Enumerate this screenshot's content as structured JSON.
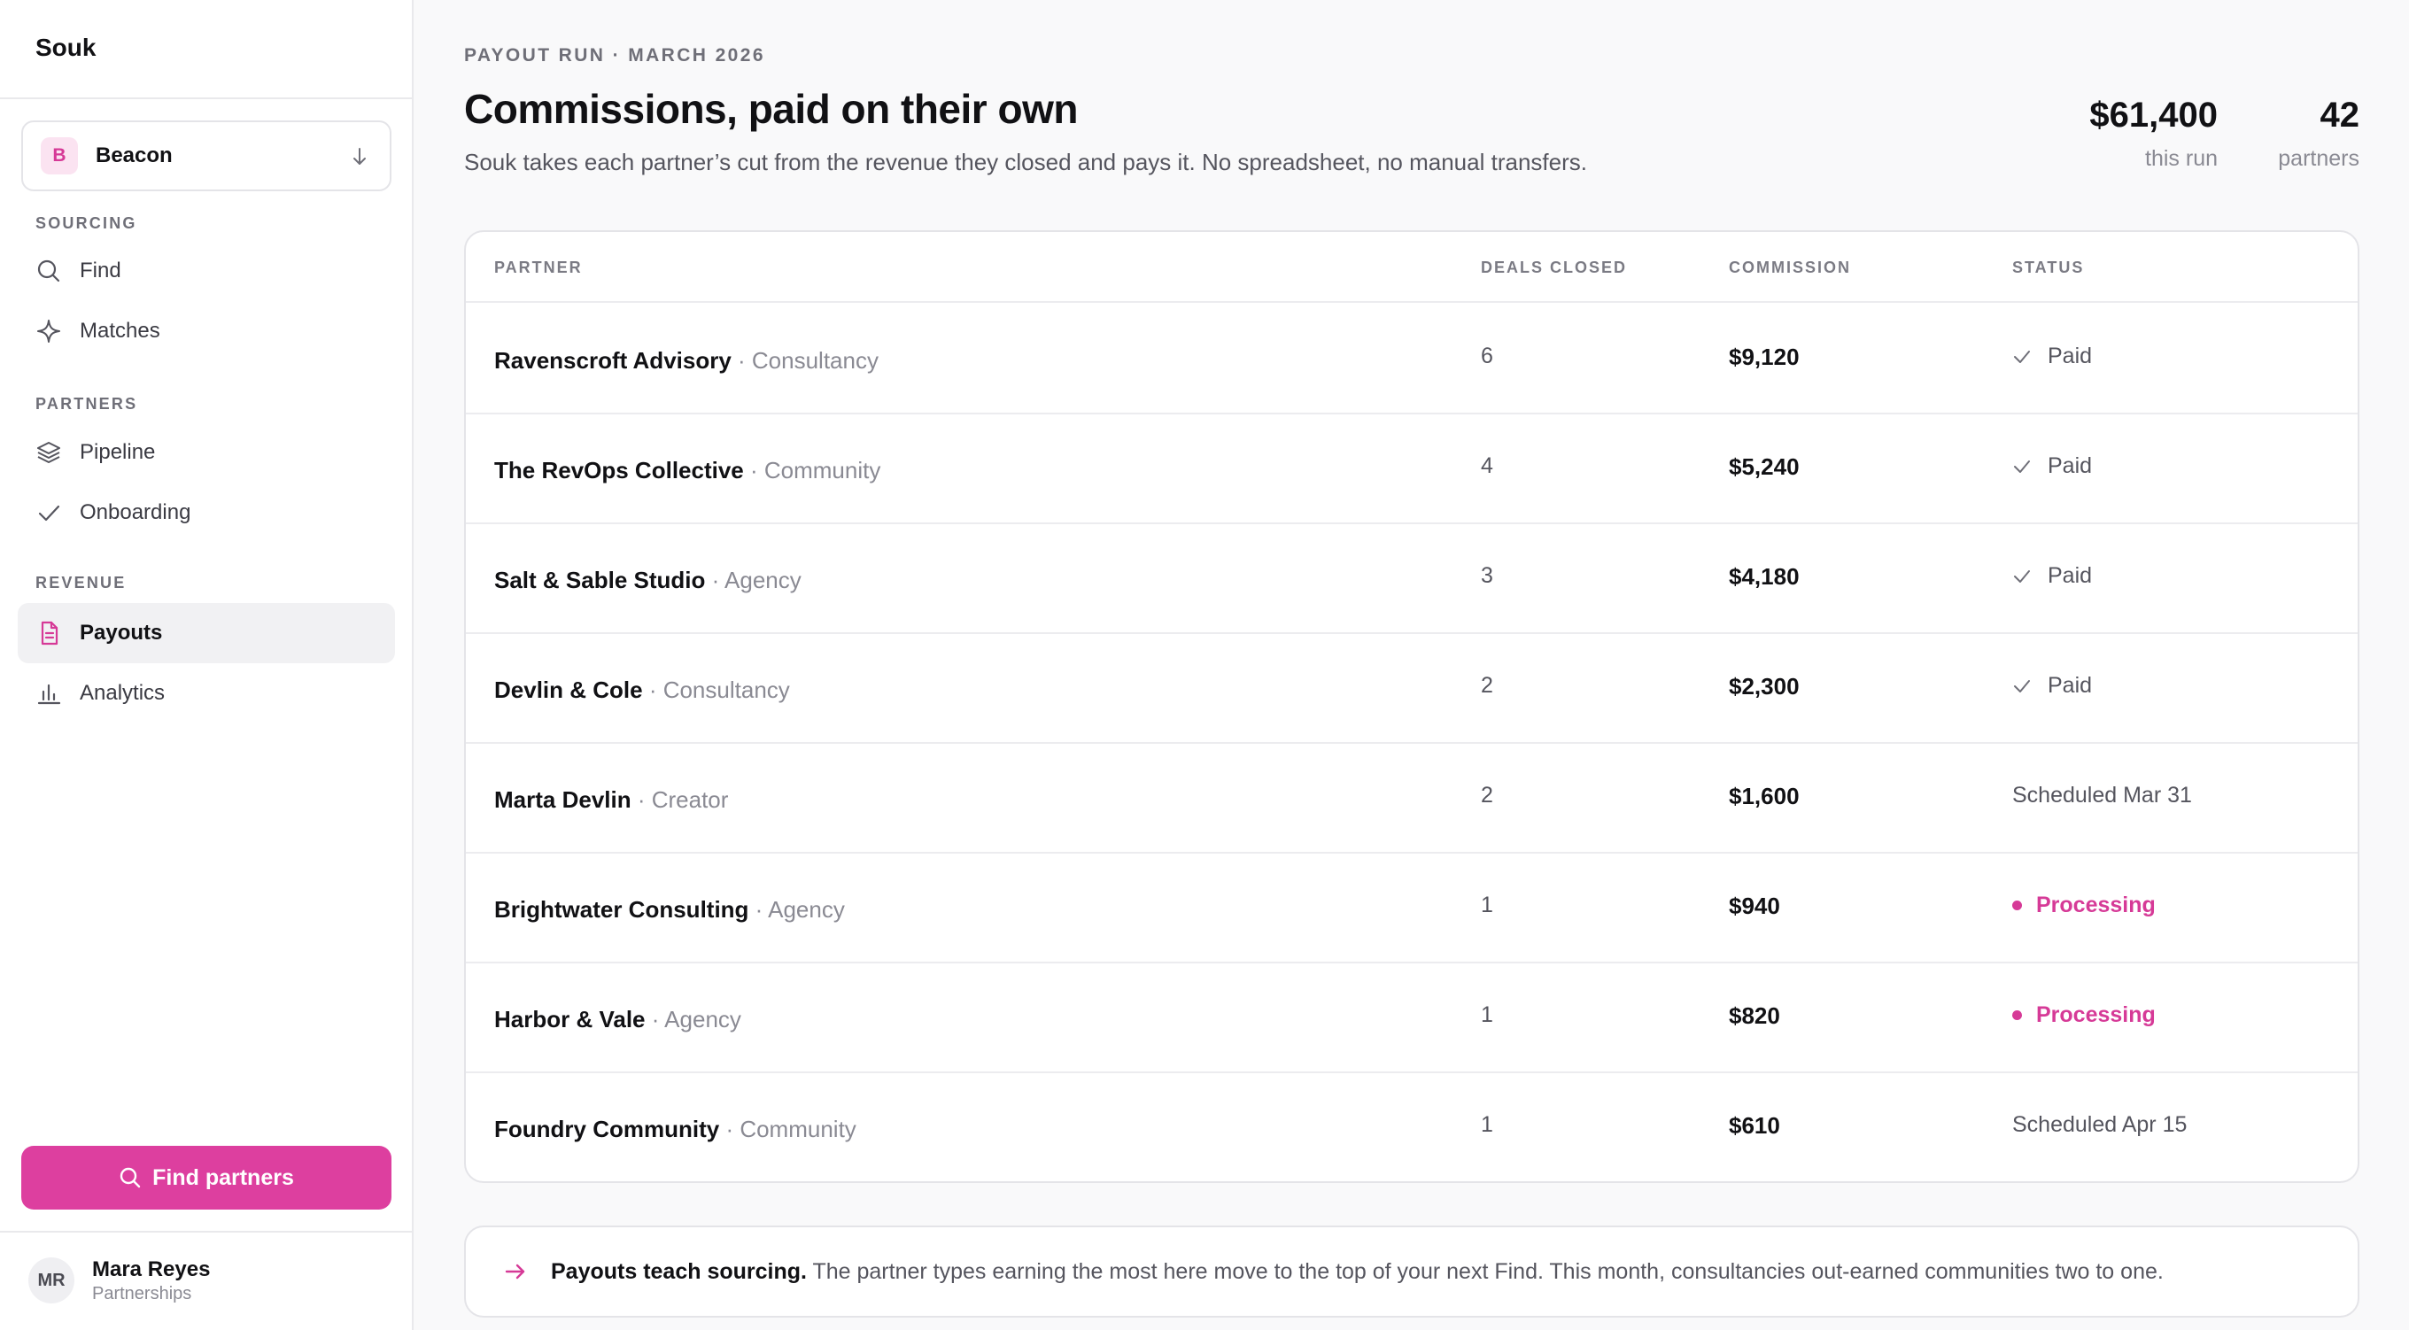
{
  "app": {
    "brand": "Souk"
  },
  "workspace": {
    "badge": "B",
    "name": "Beacon"
  },
  "sidebar": {
    "sections": [
      {
        "label": "SOURCING",
        "items": [
          {
            "label": "Find",
            "icon": "search-icon"
          },
          {
            "label": "Matches",
            "icon": "sparkle-icon"
          }
        ]
      },
      {
        "label": "PARTNERS",
        "items": [
          {
            "label": "Pipeline",
            "icon": "layers-icon"
          },
          {
            "label": "Onboarding",
            "icon": "check-icon"
          }
        ]
      },
      {
        "label": "REVENUE",
        "items": [
          {
            "label": "Payouts",
            "icon": "document-icon",
            "active": true
          },
          {
            "label": "Analytics",
            "icon": "bar-chart-icon"
          }
        ]
      }
    ],
    "cta_label": "Find partners"
  },
  "user": {
    "initials": "MR",
    "name": "Mara Reyes",
    "role": "Partnerships"
  },
  "header": {
    "eyebrow": "PAYOUT RUN · MARCH 2026",
    "title": "Commissions, paid on their own",
    "subtitle": "Souk takes each partner’s cut from the revenue they closed and pays it. No spreadsheet, no manual transfers."
  },
  "stats": [
    {
      "value": "$61,400",
      "caption": "this run"
    },
    {
      "value": "42",
      "caption": "partners"
    }
  ],
  "table": {
    "columns": {
      "partner": "PARTNER",
      "deals": "DEALS CLOSED",
      "commission": "COMMISSION",
      "status": "STATUS"
    },
    "rows": [
      {
        "name": "Ravenscroft Advisory",
        "type": " · Consultancy",
        "deals": "6",
        "commission": "$9,120",
        "status": "Paid",
        "status_kind": "paid"
      },
      {
        "name": "The RevOps Collective",
        "type": " · Community",
        "deals": "4",
        "commission": "$5,240",
        "status": "Paid",
        "status_kind": "paid"
      },
      {
        "name": "Salt & Sable Studio",
        "type": " · Agency",
        "deals": "3",
        "commission": "$4,180",
        "status": "Paid",
        "status_kind": "paid"
      },
      {
        "name": "Devlin & Cole",
        "type": " · Consultancy",
        "deals": "2",
        "commission": "$2,300",
        "status": "Paid",
        "status_kind": "paid"
      },
      {
        "name": "Marta Devlin",
        "type": " · Creator",
        "deals": "2",
        "commission": "$1,600",
        "status": "Scheduled Mar 31",
        "status_kind": "scheduled"
      },
      {
        "name": "Brightwater Consulting",
        "type": " · Agency",
        "deals": "1",
        "commission": "$940",
        "status": "Processing",
        "status_kind": "processing"
      },
      {
        "name": "Harbor & Vale",
        "type": " · Agency",
        "deals": "1",
        "commission": "$820",
        "status": "Processing",
        "status_kind": "processing"
      },
      {
        "name": "Foundry Community",
        "type": " · Community",
        "deals": "1",
        "commission": "$610",
        "status": "Scheduled Apr 15",
        "status_kind": "scheduled"
      }
    ]
  },
  "note": {
    "lead": "Payouts teach sourcing.",
    "body": " The partner types earning the most here move to the top of your next Find. This month, consultancies out-earned communities two to one."
  },
  "colors": {
    "accent": "#dd3f9f",
    "accent_text": "#d63a97",
    "badge_bg": "#fbe3f1"
  }
}
